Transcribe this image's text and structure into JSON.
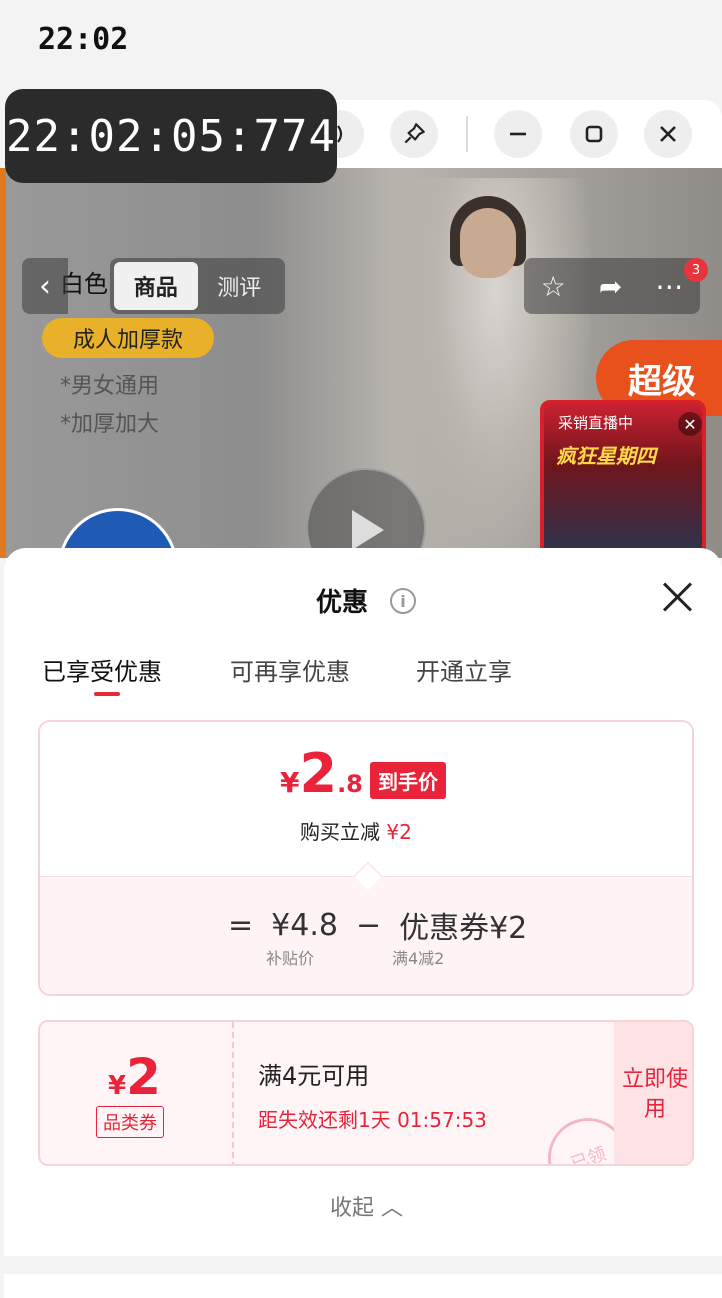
{
  "status": {
    "time": "22:02"
  },
  "overlay_clock": "22:02:05:774",
  "window_controls": {
    "minimize": "–",
    "restore": "☐",
    "close": "✕"
  },
  "product": {
    "nav_tabs": [
      "商品",
      "测评"
    ],
    "color": "白色",
    "tag": "成人加厚款",
    "specs": [
      "*男女通用",
      "*加厚加大"
    ],
    "super_tag": "超级",
    "live_title": "采销直播中",
    "live_sub": "疯狂星期四",
    "badge_count": "3"
  },
  "sheet": {
    "title": "优惠",
    "tabs": [
      "已享受优惠",
      "可再享优惠",
      "开通立享"
    ],
    "price": {
      "yen": "¥",
      "integer": "2",
      "decimal": ".8",
      "tag": "到手价",
      "instant_label": "购买立减",
      "instant_amount": "¥2"
    },
    "formula": {
      "equals": "=",
      "subsidy_price": "¥4.8",
      "subsidy_label": "补贴价",
      "minus": "−",
      "coupon_price": "优惠券¥2",
      "coupon_label": "满4减2"
    },
    "coupon": {
      "yen": "¥",
      "value": "2",
      "type": "品类券",
      "condition": "满4元可用",
      "expire": "距失效还剩1天 01:57:53",
      "use_button": "立即使用",
      "stamp": "已领"
    },
    "collapse": "收起 ︿"
  },
  "colors": {
    "accent": "#e8233a",
    "border": "#f6d3d8"
  }
}
